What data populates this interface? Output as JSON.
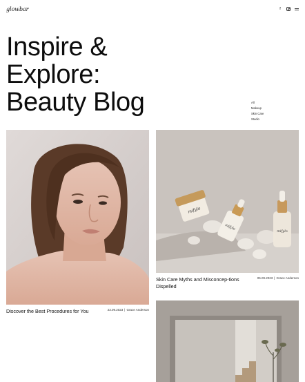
{
  "header": {
    "logo": "glowbar",
    "social": [
      {
        "icon": "facebook-icon",
        "glyph": "f"
      },
      {
        "icon": "instagram-icon",
        "glyph": ""
      },
      {
        "icon": "menu-icon",
        "glyph": ""
      }
    ]
  },
  "hero": {
    "title_line1": "Inspire &",
    "title_line2": "Explore:",
    "title_line3": "Beauty Blog"
  },
  "categories": [
    "All",
    "Makeup",
    "Skin Care",
    "Studio"
  ],
  "posts": [
    {
      "title": "Discover the Best Procedures for You",
      "date": "23.09.2023",
      "author": "Grace Anderson",
      "image": "portrait-woman"
    },
    {
      "title": "Skin Care Myths and Misconcep-tions Dispelled",
      "date": "05.09.2023",
      "author": "Grace Anderson",
      "image": "skincare-products"
    },
    {
      "title": "",
      "date": "",
      "author": "",
      "image": "interior-studio"
    }
  ],
  "colors": {
    "background": "#ffffff",
    "text": "#111111",
    "portrait_bg": "#d8d2d0",
    "product_bg": "#c9c3be"
  }
}
